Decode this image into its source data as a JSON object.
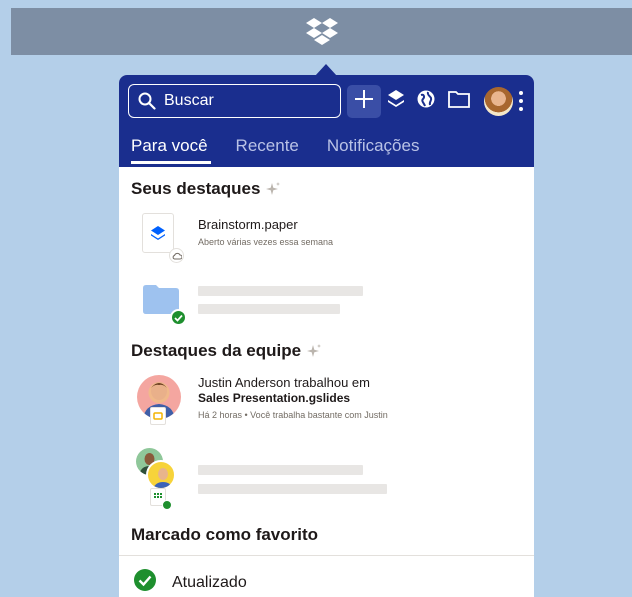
{
  "menubar": {
    "icon": "dropbox-icon"
  },
  "header": {
    "search_placeholder": "Buscar",
    "icons": [
      "search-icon",
      "plus-icon",
      "dropbox-icon",
      "globe-icon",
      "folder-icon",
      "avatar",
      "more-icon"
    ],
    "tabs": [
      {
        "label": "Para você",
        "active": true
      },
      {
        "label": "Recente",
        "active": false
      },
      {
        "label": "Notificações",
        "active": false
      }
    ]
  },
  "highlights": {
    "title": "Seus destaques",
    "items": [
      {
        "name": "Brainstorm.paper",
        "subtitle": "Aberto várias vezes essa semana",
        "badge": "cloud-icon"
      },
      {
        "name": "",
        "subtitle": "",
        "badge": "check-icon",
        "loading": true
      }
    ]
  },
  "team": {
    "title": "Destaques da equipe",
    "items": [
      {
        "line1": "Justin Anderson trabalhou em",
        "line2": "Sales Presentation.gslides",
        "subtitle": "Há 2 horas • Você trabalha bastante com Justin"
      },
      {
        "loading": true
      }
    ]
  },
  "favorites": {
    "title": "Marcado como favorito"
  },
  "status": {
    "label": "Atualizado",
    "color": "#1e8f2e"
  },
  "colors": {
    "header_bg": "#1a2e8e",
    "desktop_bg": "#b4cfe9",
    "menubar_bg": "#7d8ea4"
  }
}
